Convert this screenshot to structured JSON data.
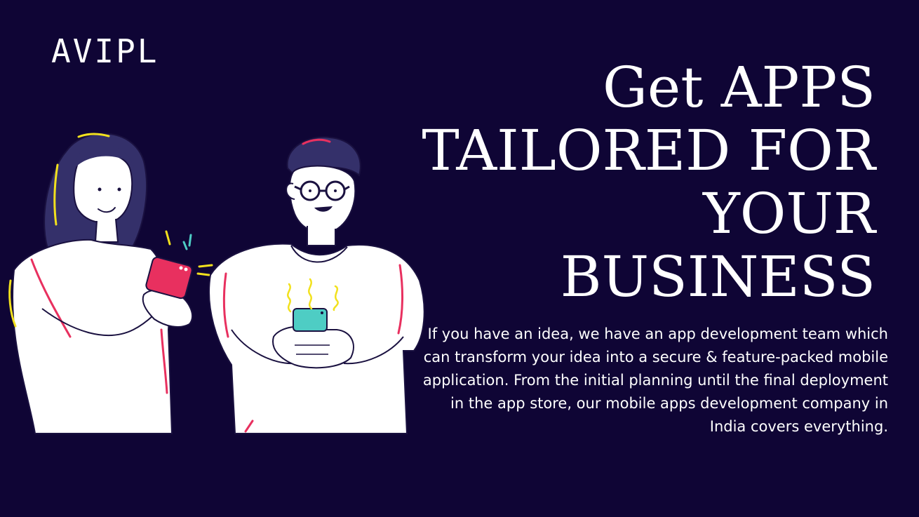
{
  "brand": {
    "name": "AVIPL"
  },
  "hero": {
    "headline_lines": [
      "Get APPS",
      "TAILORED FOR",
      "YOUR",
      "BUSINESS"
    ],
    "description": "If you have an idea, we have an app development team which can transform your idea into a secure & feature-packed mobile application. From the initial planning until the final deployment in the app store, our mobile apps development company in India covers everything."
  },
  "illustration": {
    "subject": "two-people-using-phones",
    "colors": {
      "background": "#0f0535",
      "hair": "#34306a",
      "shirt": "#ffffff",
      "outline": "#1a1140",
      "accent_pink": "#e8305f",
      "accent_yellow": "#f2e11d",
      "phone_teal": "#4ecdc4",
      "phone_pink": "#e8305f"
    }
  }
}
